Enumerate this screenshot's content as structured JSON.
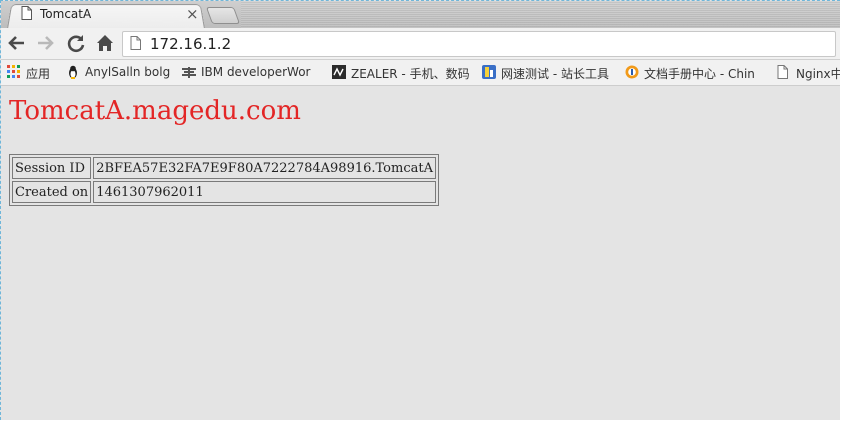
{
  "browser": {
    "tab": {
      "title": "TomcatA",
      "close_glyph": "×"
    },
    "address_bar": {
      "url": "172.16.1.2"
    },
    "bookmarks": [
      {
        "label": "应用",
        "icon": "apps-grid-icon"
      },
      {
        "label": "AnylSalln bolg",
        "icon": "penguin-icon"
      },
      {
        "label": "IBM developerWor",
        "icon": "ibm-dev-icon"
      },
      {
        "label": "ZEALER - 手机、数码",
        "icon": "zealer-icon"
      },
      {
        "label": "网速测试 - 站长工具",
        "icon": "speedtest-icon"
      },
      {
        "label": "文档手册中心 - Chin",
        "icon": "docs-icon"
      },
      {
        "label": "Nginx中",
        "icon": "page-icon"
      }
    ]
  },
  "page": {
    "heading": "TomcatA.magedu.com",
    "heading_color": "#e32626",
    "session_table": {
      "rows": [
        {
          "label": "Session ID",
          "value": "2BFEA57E32FA7E9F80A7222784A98916.TomcatA"
        },
        {
          "label": "Created on",
          "value": "1461307962011"
        }
      ]
    }
  }
}
